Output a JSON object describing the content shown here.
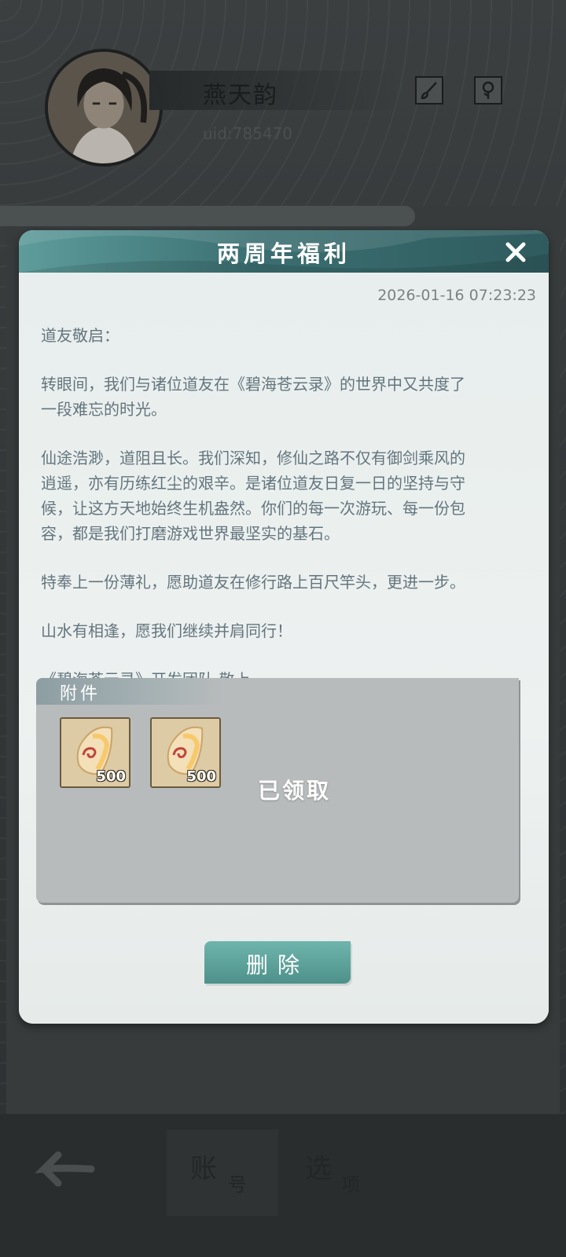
{
  "profile": {
    "name": "燕天韵",
    "uid": "uid:785470"
  },
  "icons": {
    "brush": "brush-icon",
    "flower": "flower-icon",
    "back": "back-arrow-icon",
    "close": "close-icon",
    "item": "jade-token-icon"
  },
  "nav": {
    "account_big": "账",
    "account_small": "号",
    "options_big": "选",
    "options_small": "项"
  },
  "mail": {
    "title": "两周年福利",
    "date": "2026-01-16 07:23:23",
    "greeting": "道友敬启：",
    "p1_l1": "转眼间，我们与诸位道友在《碧海苍云录》的世界中又共度了",
    "p1_l2": "一段难忘的时光。",
    "p2_l1": "仙途浩渺，道阻且长。我们深知，修仙之路不仅有御剑乘风的",
    "p2_l2": "逍遥，亦有历练红尘的艰辛。是诸位道友日复一日的坚持与守",
    "p2_l3": "候，让这方天地始终生机盎然。你们的每一次游玩、每一份包",
    "p2_l4": "容，都是我们打磨游戏世界最坚实的基石。",
    "p3": "特奉上一份薄礼，愿助道友在修行路上百尺竿头，更进一步。",
    "p4": "山水有相逢，愿我们继续并肩同行！",
    "signature": "《碧海苍云录》开发团队 敬上"
  },
  "attachments": {
    "label": "附件",
    "items": [
      {
        "count": "500"
      },
      {
        "count": "500"
      }
    ],
    "status": "已领取"
  },
  "actions": {
    "delete_label": "删除"
  },
  "colors": {
    "header_teal": "#3b6f71",
    "button_teal": "#5da39b",
    "text": "#64757e"
  }
}
